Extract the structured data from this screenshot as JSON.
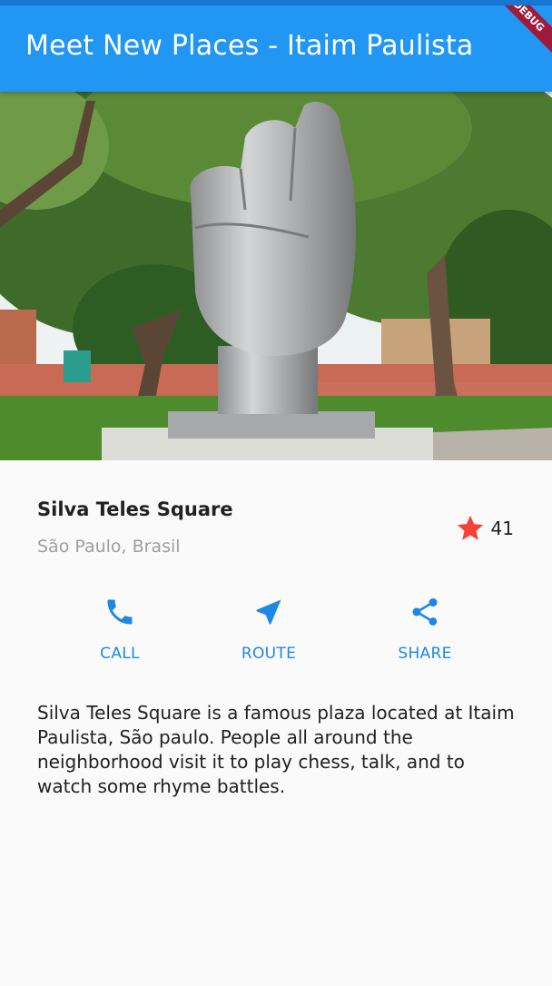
{
  "app_bar": {
    "title": "Meet New Places - Itaim Paulista",
    "debug_label": "DEBUG"
  },
  "place": {
    "name": "Silva Teles Square",
    "location": "São Paulo, Brasil",
    "rating_count": "41",
    "description": "Silva Teles Square is a famous plaza located at Itaim Paulista, São paulo. People all around the neighborhood visit it to play chess, talk, and to watch some rhyme battles."
  },
  "actions": [
    {
      "label": "CALL",
      "icon": "phone-icon"
    },
    {
      "label": "ROUTE",
      "icon": "navigation-icon"
    },
    {
      "label": "SHARE",
      "icon": "share-icon"
    }
  ],
  "colors": {
    "primary": "#2196f3",
    "accent": "#1e88e5",
    "star": "#f44336"
  }
}
